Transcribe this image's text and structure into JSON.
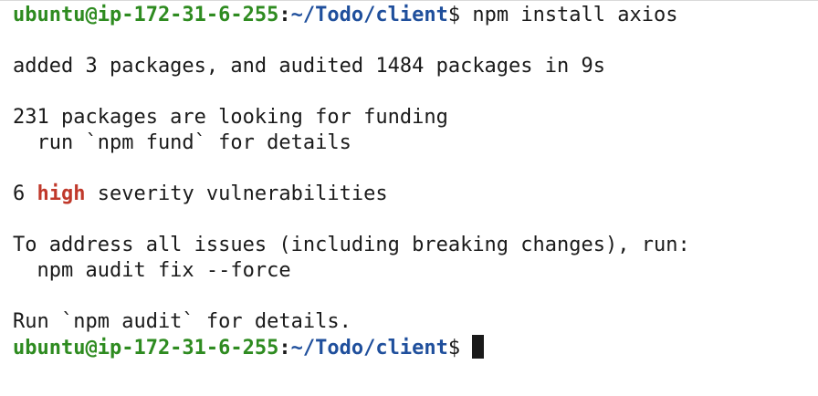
{
  "prompt": {
    "user_host": "ubuntu@ip-172-31-6-255",
    "separator": ":",
    "path": "~/Todo/client",
    "symbol": "$"
  },
  "command": "npm install axios",
  "output": {
    "added": "added 3 packages, and audited 1484 packages in 9s",
    "funding_line": "231 packages are looking for funding",
    "funding_hint": "  run `npm fund` for details",
    "vuln_count": "6 ",
    "vuln_severity": "high",
    "vuln_tail": " severity vulnerabilities",
    "fix_intro": "To address all issues (including breaking changes), run:",
    "fix_command": "  npm audit fix --force",
    "details": "Run `npm audit` for details."
  },
  "colors": {
    "prompt_user": "#2e8b20",
    "prompt_path": "#1f4f9c",
    "severity_high": "#c0392b",
    "text": "#1a1a1a",
    "background": "#ffffff"
  }
}
